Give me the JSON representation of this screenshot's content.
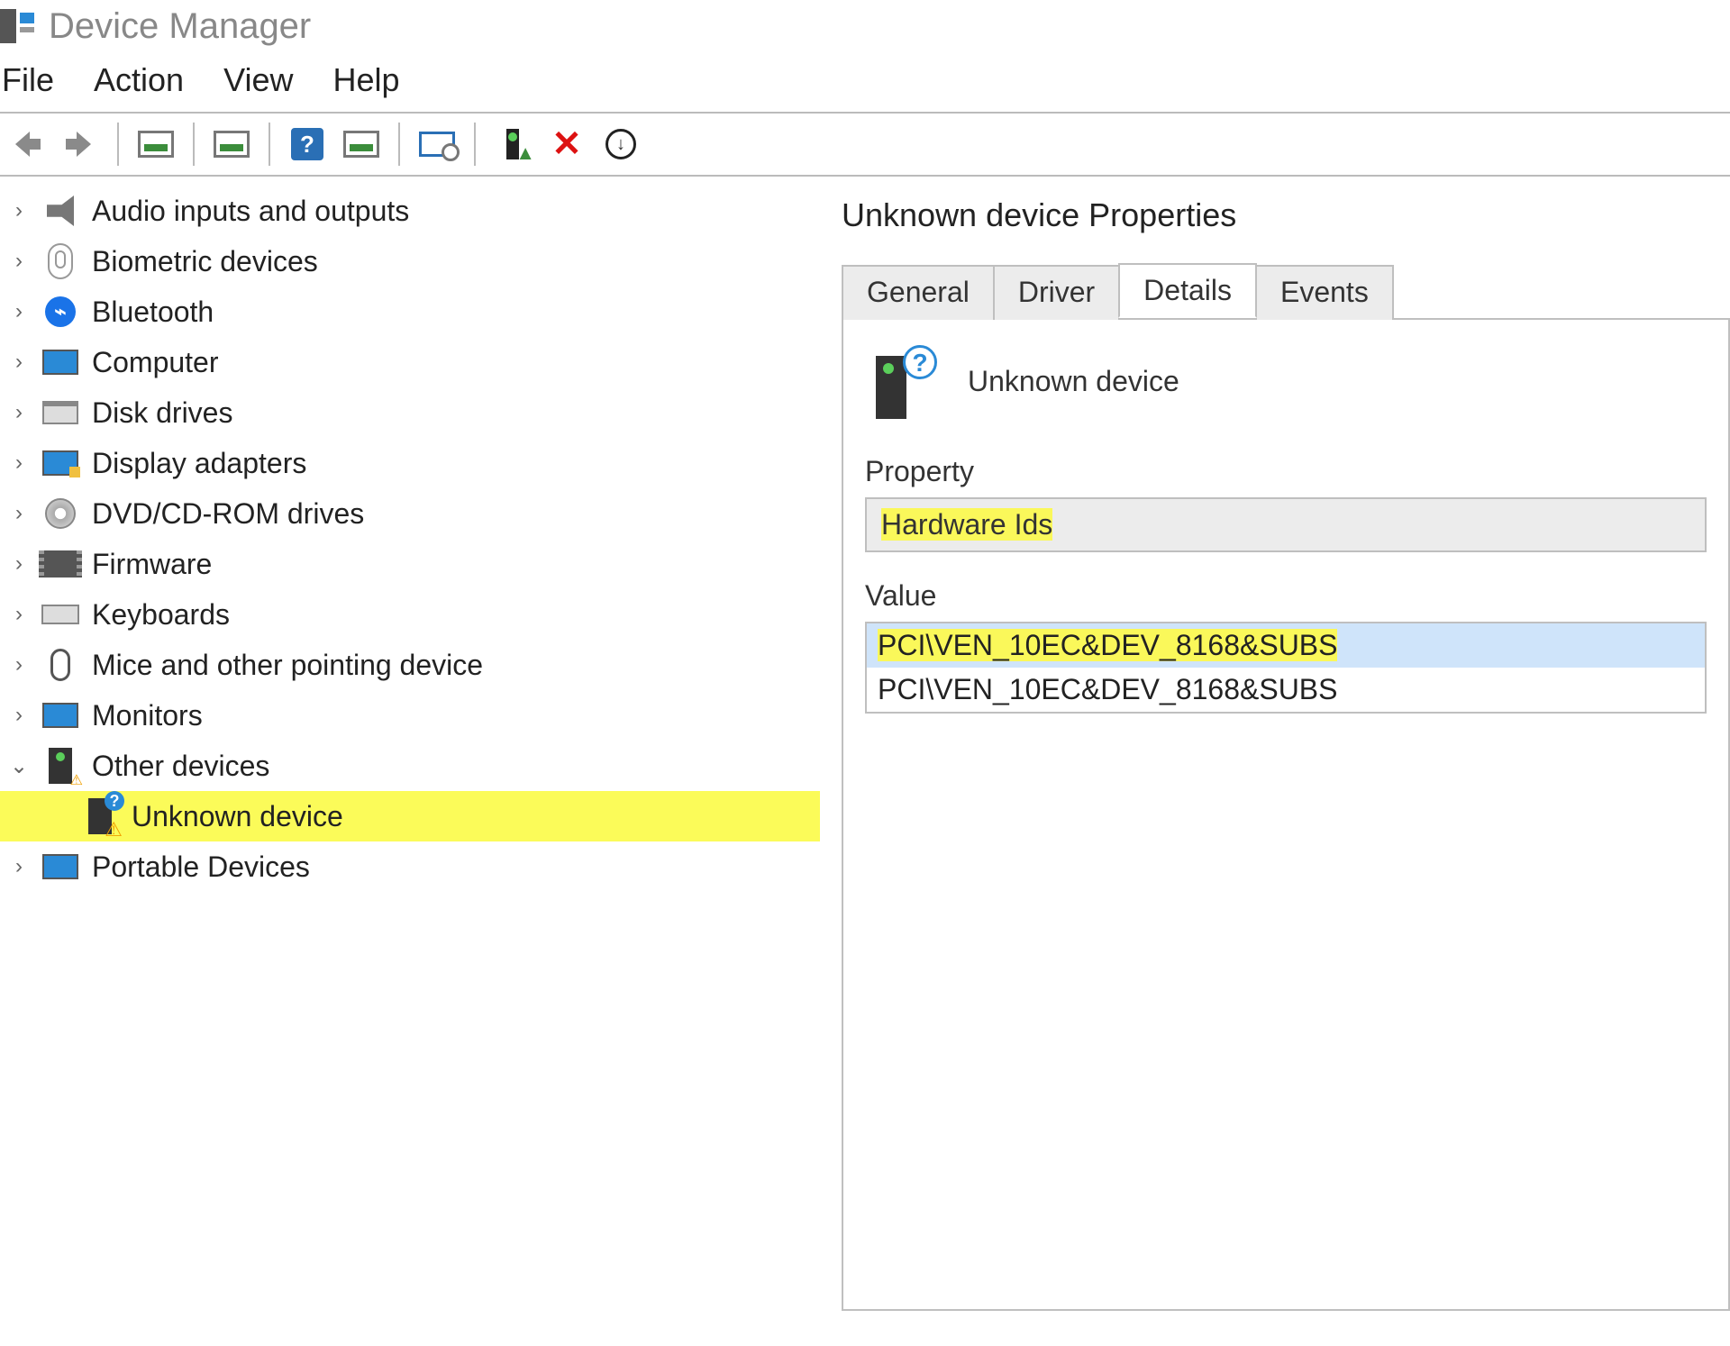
{
  "window": {
    "title": "Device Manager"
  },
  "menu": {
    "file": "File",
    "action": "Action",
    "view": "View",
    "help": "Help"
  },
  "tree": {
    "items": [
      {
        "label": "Audio inputs and outputs",
        "icon": "speaker"
      },
      {
        "label": "Biometric devices",
        "icon": "finger"
      },
      {
        "label": "Bluetooth",
        "icon": "bt"
      },
      {
        "label": "Computer",
        "icon": "mon"
      },
      {
        "label": "Disk drives",
        "icon": "disk"
      },
      {
        "label": "Display adapters",
        "icon": "disp"
      },
      {
        "label": "DVD/CD-ROM drives",
        "icon": "dvd"
      },
      {
        "label": "Firmware",
        "icon": "chip"
      },
      {
        "label": "Keyboards",
        "icon": "kbd"
      },
      {
        "label": "Mice and other pointing device",
        "icon": "mouse"
      },
      {
        "label": "Monitors",
        "icon": "mon"
      },
      {
        "label": "Other devices",
        "icon": "other",
        "expanded": true
      },
      {
        "label": "Unknown device",
        "icon": "unknown",
        "child": true,
        "highlight": true
      },
      {
        "label": "Portable Devices",
        "icon": "port"
      }
    ]
  },
  "props": {
    "title": "Unknown device Properties",
    "tabs": {
      "general": "General",
      "driver": "Driver",
      "details": "Details",
      "events": "Events"
    },
    "device_name": "Unknown device",
    "property_label": "Property",
    "property_value": "Hardware Ids",
    "value_label": "Value",
    "values": [
      "PCI\\VEN_10EC&DEV_8168&SUBS",
      "PCI\\VEN_10EC&DEV_8168&SUBS"
    ]
  }
}
